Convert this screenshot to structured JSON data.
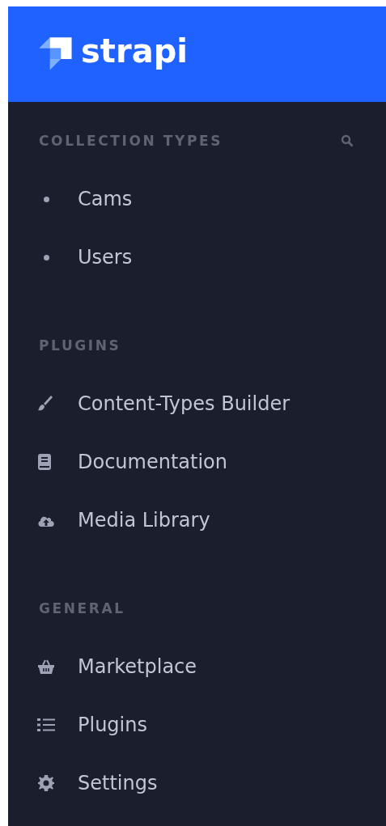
{
  "logo": {
    "text": "strapi"
  },
  "sections": [
    {
      "title": "COLLECTION TYPES",
      "search": true,
      "items": [
        {
          "label": "Cams",
          "kind": "bullet"
        },
        {
          "label": "Users",
          "kind": "bullet"
        }
      ]
    },
    {
      "title": "PLUGINS",
      "search": false,
      "items": [
        {
          "label": "Content-Types Builder",
          "kind": "brush"
        },
        {
          "label": "Documentation",
          "kind": "book"
        },
        {
          "label": "Media Library",
          "kind": "cloud"
        }
      ]
    },
    {
      "title": "GENERAL",
      "search": false,
      "items": [
        {
          "label": "Marketplace",
          "kind": "basket"
        },
        {
          "label": "Plugins",
          "kind": "list"
        },
        {
          "label": "Settings",
          "kind": "gear"
        }
      ]
    }
  ]
}
